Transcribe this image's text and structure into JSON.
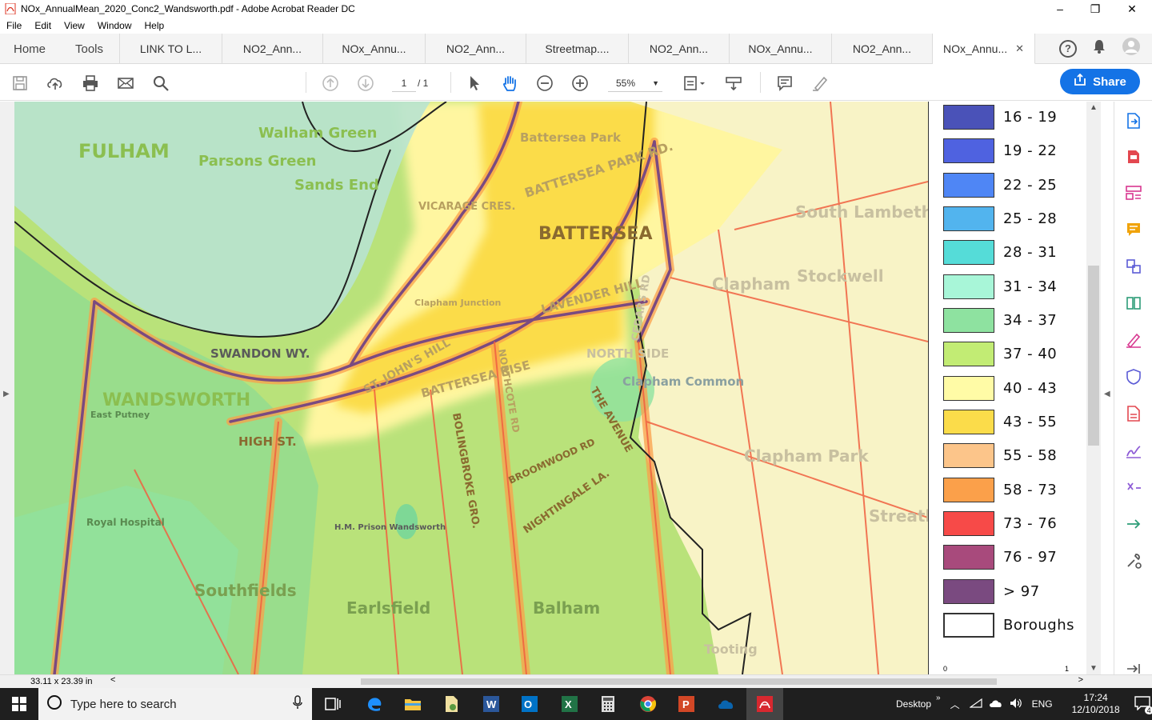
{
  "window": {
    "title": "NOx_AnnualMean_2020_Conc2_Wandsworth.pdf - Adobe Acrobat Reader DC",
    "controls": [
      "–",
      "❐",
      "✕"
    ]
  },
  "menu": [
    "File",
    "Edit",
    "View",
    "Window",
    "Help"
  ],
  "nav_tabs": [
    "Home",
    "Tools"
  ],
  "doc_tabs": [
    {
      "label": "LINK TO L..."
    },
    {
      "label": "NO2_Ann..."
    },
    {
      "label": "NOx_Annu..."
    },
    {
      "label": "NO2_Ann..."
    },
    {
      "label": "Streetmap...."
    },
    {
      "label": "NO2_Ann..."
    },
    {
      "label": "NOx_Annu..."
    },
    {
      "label": "NO2_Ann..."
    },
    {
      "label": "NOx_Annu...",
      "active": true
    }
  ],
  "tab_close": "✕",
  "help_glyph": "?",
  "toolbar": {
    "page_current": "1",
    "page_total": "/ 1",
    "zoom": "55%",
    "share_label": "Share"
  },
  "map": {
    "place_labels": [
      "FULHAM",
      "Parsons Green",
      "Walham Green",
      "Sands End",
      "BATTERSEA",
      "Battersea Park",
      "BATTERSEA PARK RD.",
      "VICARAGE CRES.",
      "LAVENDER HILL",
      "Clapham Junction",
      "SWANDON WY.",
      "WANDSWORTH",
      "HIGH ST.",
      "ST. JOHN'S HILL",
      "BATTERSEA RISE",
      "NORTHCOTE RD",
      "Clapham Common",
      "Clapham",
      "Stockwell",
      "South Lambeth",
      "Clapham Park",
      "Streatham Hill",
      "Southfields",
      "Earlsfield",
      "Balham",
      "Royal Hospital",
      "East Putney",
      "Tooting",
      "BOLINGBROKE GRO.",
      "NIGHTINGALE LA.",
      "THE AVENUE",
      "H.M. Prison Wandsworth",
      "BROOMWOOD RD",
      "NORTH SIDE",
      "CEDARS RD"
    ]
  },
  "legend": {
    "items": [
      {
        "label": "16 - 19",
        "color": "#4a52b8"
      },
      {
        "label": "19 - 22",
        "color": "#4f62e0"
      },
      {
        "label": "22 - 25",
        "color": "#4f86f5"
      },
      {
        "label": "25 - 28",
        "color": "#52b4ee"
      },
      {
        "label": "28 - 31",
        "color": "#55dcd8"
      },
      {
        "label": "31 - 34",
        "color": "#a8f6d8"
      },
      {
        "label": "34 - 37",
        "color": "#8ee2a0"
      },
      {
        "label": "37 - 40",
        "color": "#c2ec74"
      },
      {
        "label": "40 - 43",
        "color": "#fffba6"
      },
      {
        "label": "43 - 55",
        "color": "#fbdc4a"
      },
      {
        "label": "55 - 58",
        "color": "#fcc58a"
      },
      {
        "label": "58 - 73",
        "color": "#fba04a"
      },
      {
        "label": "73 - 76",
        "color": "#f74a48"
      },
      {
        "label": "76 - 97",
        "color": "#a84a7c"
      },
      {
        "label": "> 97",
        "color": "#7a4a80"
      },
      {
        "label": "Boroughs",
        "color": "#ffffff"
      }
    ],
    "tick_left": "0",
    "tick_right": "1"
  },
  "status": {
    "page_size": "33.11 x 23.39 in"
  },
  "taskbar": {
    "search_placeholder": "Type here to search",
    "desktop_label": "Desktop",
    "lang": "ENG",
    "time": "17:24",
    "date": "12/10/2018",
    "notifications": "4"
  }
}
